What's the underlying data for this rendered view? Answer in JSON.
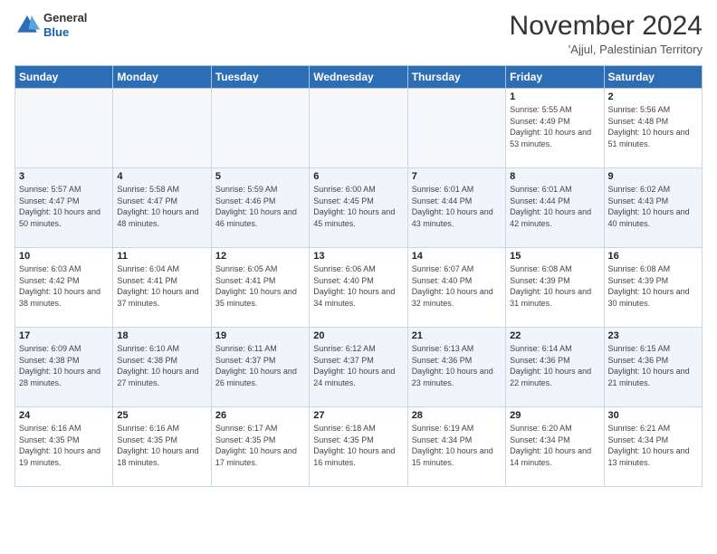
{
  "header": {
    "logo_general": "General",
    "logo_blue": "Blue",
    "month_title": "November 2024",
    "location": "'Ajjul, Palestinian Territory"
  },
  "days_of_week": [
    "Sunday",
    "Monday",
    "Tuesday",
    "Wednesday",
    "Thursday",
    "Friday",
    "Saturday"
  ],
  "weeks": [
    [
      {
        "day": "",
        "empty": true
      },
      {
        "day": "",
        "empty": true
      },
      {
        "day": "",
        "empty": true
      },
      {
        "day": "",
        "empty": true
      },
      {
        "day": "",
        "empty": true
      },
      {
        "day": "1",
        "sunrise": "Sunrise: 5:55 AM",
        "sunset": "Sunset: 4:49 PM",
        "daylight": "Daylight: 10 hours and 53 minutes."
      },
      {
        "day": "2",
        "sunrise": "Sunrise: 5:56 AM",
        "sunset": "Sunset: 4:48 PM",
        "daylight": "Daylight: 10 hours and 51 minutes."
      }
    ],
    [
      {
        "day": "3",
        "sunrise": "Sunrise: 5:57 AM",
        "sunset": "Sunset: 4:47 PM",
        "daylight": "Daylight: 10 hours and 50 minutes."
      },
      {
        "day": "4",
        "sunrise": "Sunrise: 5:58 AM",
        "sunset": "Sunset: 4:47 PM",
        "daylight": "Daylight: 10 hours and 48 minutes."
      },
      {
        "day": "5",
        "sunrise": "Sunrise: 5:59 AM",
        "sunset": "Sunset: 4:46 PM",
        "daylight": "Daylight: 10 hours and 46 minutes."
      },
      {
        "day": "6",
        "sunrise": "Sunrise: 6:00 AM",
        "sunset": "Sunset: 4:45 PM",
        "daylight": "Daylight: 10 hours and 45 minutes."
      },
      {
        "day": "7",
        "sunrise": "Sunrise: 6:01 AM",
        "sunset": "Sunset: 4:44 PM",
        "daylight": "Daylight: 10 hours and 43 minutes."
      },
      {
        "day": "8",
        "sunrise": "Sunrise: 6:01 AM",
        "sunset": "Sunset: 4:44 PM",
        "daylight": "Daylight: 10 hours and 42 minutes."
      },
      {
        "day": "9",
        "sunrise": "Sunrise: 6:02 AM",
        "sunset": "Sunset: 4:43 PM",
        "daylight": "Daylight: 10 hours and 40 minutes."
      }
    ],
    [
      {
        "day": "10",
        "sunrise": "Sunrise: 6:03 AM",
        "sunset": "Sunset: 4:42 PM",
        "daylight": "Daylight: 10 hours and 38 minutes."
      },
      {
        "day": "11",
        "sunrise": "Sunrise: 6:04 AM",
        "sunset": "Sunset: 4:41 PM",
        "daylight": "Daylight: 10 hours and 37 minutes."
      },
      {
        "day": "12",
        "sunrise": "Sunrise: 6:05 AM",
        "sunset": "Sunset: 4:41 PM",
        "daylight": "Daylight: 10 hours and 35 minutes."
      },
      {
        "day": "13",
        "sunrise": "Sunrise: 6:06 AM",
        "sunset": "Sunset: 4:40 PM",
        "daylight": "Daylight: 10 hours and 34 minutes."
      },
      {
        "day": "14",
        "sunrise": "Sunrise: 6:07 AM",
        "sunset": "Sunset: 4:40 PM",
        "daylight": "Daylight: 10 hours and 32 minutes."
      },
      {
        "day": "15",
        "sunrise": "Sunrise: 6:08 AM",
        "sunset": "Sunset: 4:39 PM",
        "daylight": "Daylight: 10 hours and 31 minutes."
      },
      {
        "day": "16",
        "sunrise": "Sunrise: 6:08 AM",
        "sunset": "Sunset: 4:39 PM",
        "daylight": "Daylight: 10 hours and 30 minutes."
      }
    ],
    [
      {
        "day": "17",
        "sunrise": "Sunrise: 6:09 AM",
        "sunset": "Sunset: 4:38 PM",
        "daylight": "Daylight: 10 hours and 28 minutes."
      },
      {
        "day": "18",
        "sunrise": "Sunrise: 6:10 AM",
        "sunset": "Sunset: 4:38 PM",
        "daylight": "Daylight: 10 hours and 27 minutes."
      },
      {
        "day": "19",
        "sunrise": "Sunrise: 6:11 AM",
        "sunset": "Sunset: 4:37 PM",
        "daylight": "Daylight: 10 hours and 26 minutes."
      },
      {
        "day": "20",
        "sunrise": "Sunrise: 6:12 AM",
        "sunset": "Sunset: 4:37 PM",
        "daylight": "Daylight: 10 hours and 24 minutes."
      },
      {
        "day": "21",
        "sunrise": "Sunrise: 6:13 AM",
        "sunset": "Sunset: 4:36 PM",
        "daylight": "Daylight: 10 hours and 23 minutes."
      },
      {
        "day": "22",
        "sunrise": "Sunrise: 6:14 AM",
        "sunset": "Sunset: 4:36 PM",
        "daylight": "Daylight: 10 hours and 22 minutes."
      },
      {
        "day": "23",
        "sunrise": "Sunrise: 6:15 AM",
        "sunset": "Sunset: 4:36 PM",
        "daylight": "Daylight: 10 hours and 21 minutes."
      }
    ],
    [
      {
        "day": "24",
        "sunrise": "Sunrise: 6:16 AM",
        "sunset": "Sunset: 4:35 PM",
        "daylight": "Daylight: 10 hours and 19 minutes."
      },
      {
        "day": "25",
        "sunrise": "Sunrise: 6:16 AM",
        "sunset": "Sunset: 4:35 PM",
        "daylight": "Daylight: 10 hours and 18 minutes."
      },
      {
        "day": "26",
        "sunrise": "Sunrise: 6:17 AM",
        "sunset": "Sunset: 4:35 PM",
        "daylight": "Daylight: 10 hours and 17 minutes."
      },
      {
        "day": "27",
        "sunrise": "Sunrise: 6:18 AM",
        "sunset": "Sunset: 4:35 PM",
        "daylight": "Daylight: 10 hours and 16 minutes."
      },
      {
        "day": "28",
        "sunrise": "Sunrise: 6:19 AM",
        "sunset": "Sunset: 4:34 PM",
        "daylight": "Daylight: 10 hours and 15 minutes."
      },
      {
        "day": "29",
        "sunrise": "Sunrise: 6:20 AM",
        "sunset": "Sunset: 4:34 PM",
        "daylight": "Daylight: 10 hours and 14 minutes."
      },
      {
        "day": "30",
        "sunrise": "Sunrise: 6:21 AM",
        "sunset": "Sunset: 4:34 PM",
        "daylight": "Daylight: 10 hours and 13 minutes."
      }
    ]
  ]
}
